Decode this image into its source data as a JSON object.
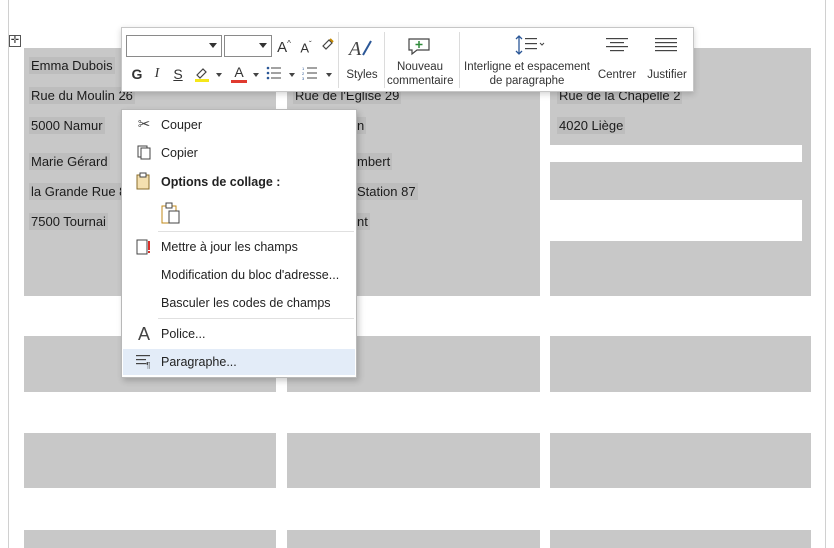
{
  "document": {
    "addresses": [
      {
        "name": "Emma Dubois",
        "street": "Rue du Moulin 26",
        "city": "5000  Namur"
      },
      {
        "street": "Rue de l'Eglise 29",
        "city_partial": "n"
      },
      {
        "street": "Rue de la Chapelle 2",
        "city": "4020  Liège"
      },
      {
        "name": "Marie Gérard",
        "street": "la Grande Rue 8",
        "city": "7500  Tournai"
      },
      {
        "name_partial": "mbert",
        "street_partial": "Station 87",
        "city_partial": "nt"
      }
    ]
  },
  "toolbar": {
    "font_name": "",
    "font_size": "",
    "grow_font": "A",
    "shrink_font": "A",
    "bold": "G",
    "italic": "I",
    "underline": "S",
    "font_color_letter": "A",
    "highlight_color": "#f5e71a",
    "font_color": "#e03a2f",
    "styles_label": "Styles",
    "new_comment_label": [
      "Nouveau",
      "commentaire"
    ],
    "line_spacing_label": [
      "Interligne et espacement",
      "de paragraphe"
    ],
    "center_label": "Centrer",
    "justify_label": "Justifier"
  },
  "context_menu": {
    "cut": "Couper",
    "copy": "Copier",
    "paste_options": "Options de collage :",
    "update_fields": "Mettre à jour les champs",
    "edit_address_block": "Modification du bloc d'adresse...",
    "toggle_field_codes": "Basculer les codes de champs",
    "font": "Police...",
    "paragraph": "Paragraphe..."
  }
}
